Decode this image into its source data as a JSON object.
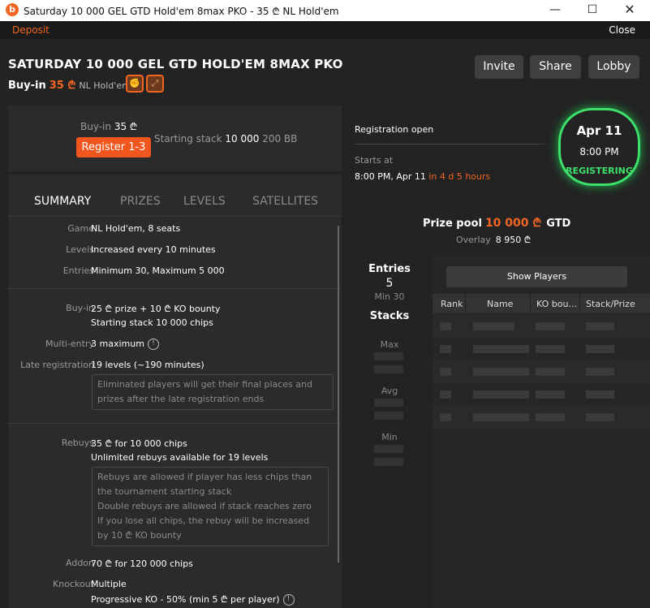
{
  "window": {
    "title": "Saturday 10 000 GEL GTD Hold'em 8max PKO - 35 ₾ NL Hold'em",
    "logo_letter": "b"
  },
  "topbar": {
    "deposit": "Deposit",
    "close": "Close"
  },
  "header": {
    "title": "SATURDAY 10 000 GEL GTD HOLD'EM 8MAX PKO",
    "buyin_label": "Buy-in",
    "buyin_amount": "35 ₾",
    "game": "NL Hold'em",
    "buttons": {
      "invite": "Invite",
      "share": "Share",
      "lobby": "Lobby"
    }
  },
  "registration": {
    "buyin_label": "Buy-in",
    "buyin_value": "35 ₾",
    "register_button": "Register 1-3",
    "stack_label": "Starting stack",
    "stack_value": "10 000",
    "stack_bb": "200 BB"
  },
  "status": {
    "registration_open": "Registration open",
    "starts_at_label": "Starts at",
    "starts_at_value": "8:00 PM, Apr 11",
    "starts_in": "in 4 d 5 hours",
    "date": "Apr 11",
    "time": "8:00 PM",
    "state": "REGISTERING"
  },
  "tabs": [
    "SUMMARY",
    "PRIZES",
    "LEVELS",
    "SATELLITES"
  ],
  "summary": {
    "game_k": "Game",
    "game_v": "NL Hold'em, 8 seats",
    "levels_k": "Levels",
    "levels_v": "Increased every 10 minutes",
    "entries_k": "Entries",
    "entries_v": "Minimum 30, Maximum 5 000",
    "buyin_k": "Buy-in",
    "buyin_v": "25 ₾ prize + 10 ₾ KO bounty",
    "buyin_v2": "Starting stack 10 000 chips",
    "multi_k": "Multi-entry",
    "multi_v": "3 maximum",
    "late_k": "Late registration",
    "late_v": "19 levels (~190 minutes)",
    "late_note": "Eliminated players will get their final places and prizes after the late registration ends",
    "rebuys_k": "Rebuys",
    "rebuys_v": "35 ₾ for 10 000 chips",
    "rebuys_v2": "Unlimited rebuys available for 19 levels",
    "rebuys_note1": "Rebuys are allowed if player has less chips than the tournament starting stack",
    "rebuys_note2": "Double rebuys are allowed if stack reaches zero",
    "rebuys_note3": "If you lose all chips, the rebuy will be increased by 10 ₾ KO bounty",
    "addon_k": "Addon",
    "addon_v": "70 ₾ for 120 000 chips",
    "knockout_k": "Knockout",
    "knockout_v": "Multiple",
    "knockout_v2": "Progressive KO - 50% (min 5 ₾ per player)"
  },
  "prize": {
    "label": "Prize pool",
    "amount": "10 000 ₾",
    "gtd": "GTD",
    "overlay_label": "Overlay",
    "overlay_value": "8 950 ₾"
  },
  "entries": {
    "label": "Entries",
    "count": "5",
    "min": "Min 30",
    "stacks_label": "Stacks",
    "max": "Max",
    "avg": "Avg",
    "min_stack": "Min"
  },
  "players": {
    "show_button": "Show Players",
    "columns": [
      "Rank",
      "Name",
      "KO bou...",
      "Stack/Prize"
    ]
  },
  "colors": {
    "accent": "#f26522",
    "registering": "#3ee06c"
  }
}
